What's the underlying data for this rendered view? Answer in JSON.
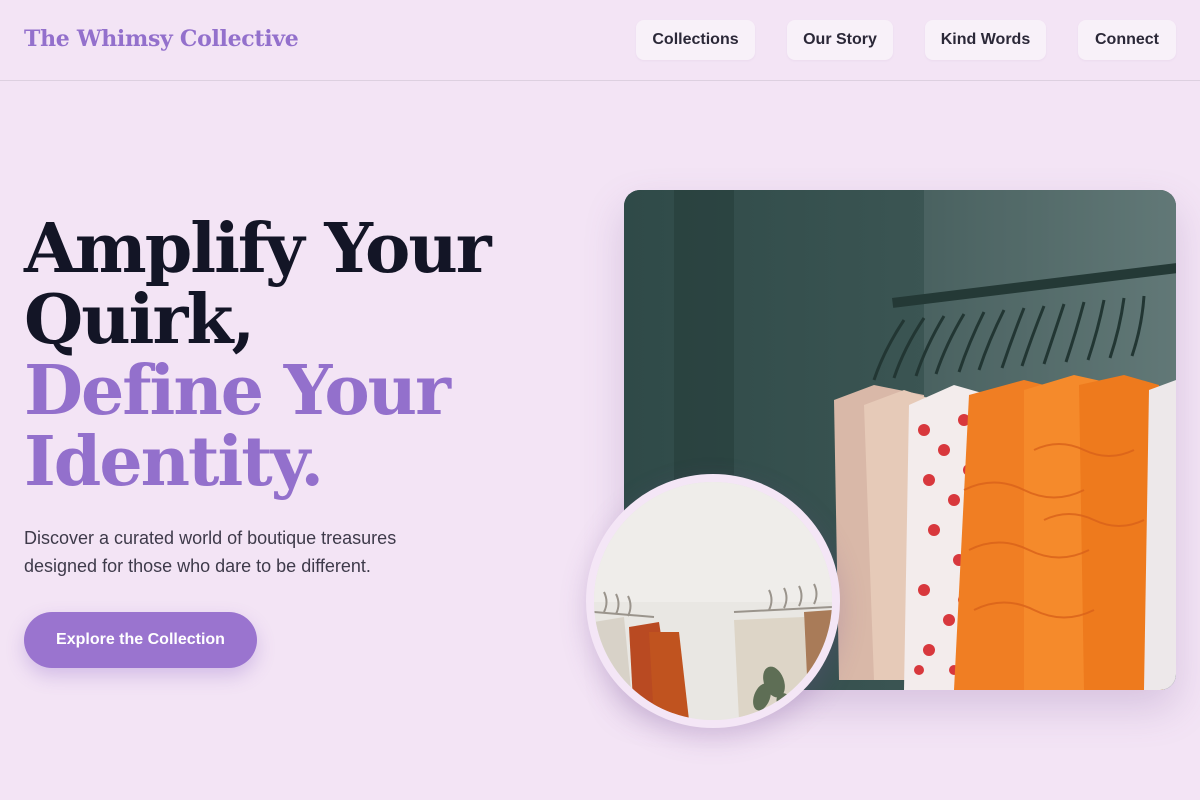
{
  "header": {
    "brand": "The Whimsy Collective",
    "nav": [
      {
        "label": "Collections"
      },
      {
        "label": "Our Story"
      },
      {
        "label": "Kind Words"
      },
      {
        "label": "Connect"
      }
    ]
  },
  "hero": {
    "headline_line1": "Amplify Your",
    "headline_line2": "Quirk,",
    "headline_line3": "Define Your",
    "headline_line4": "Identity.",
    "subtext": "Discover a curated world of boutique treasures designed for those who dare to be different.",
    "cta_label": "Explore the Collection"
  },
  "colors": {
    "background": "#f3e4f5",
    "accent": "#9370cc",
    "heading": "#131526",
    "cta": "#9a74cf"
  }
}
